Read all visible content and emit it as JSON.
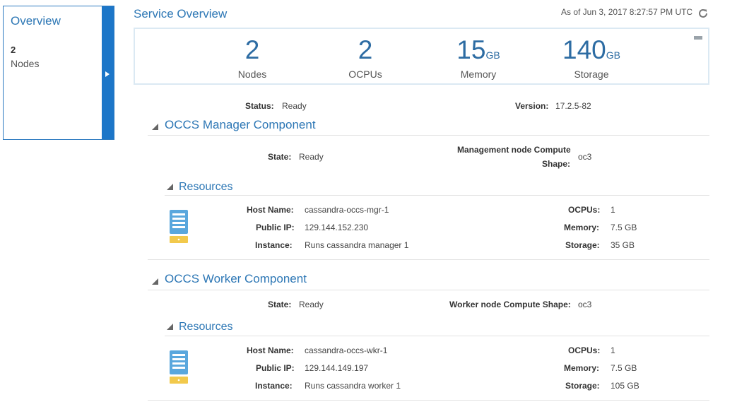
{
  "sidebar": {
    "title": "Overview",
    "count": "2",
    "count_label": "Nodes"
  },
  "header": {
    "title": "Service Overview",
    "as_of": "As of Jun 3, 2017 8:27:57 PM UTC"
  },
  "metrics": [
    {
      "value": "2",
      "unit": "",
      "label": "Nodes"
    },
    {
      "value": "2",
      "unit": "",
      "label": "OCPUs"
    },
    {
      "value": "15",
      "unit": "GB",
      "label": "Memory"
    },
    {
      "value": "140",
      "unit": "GB",
      "label": "Storage"
    }
  ],
  "status": {
    "status_label": "Status:",
    "status_value": "Ready",
    "version_label": "Version:",
    "version_value": "17.2.5-82"
  },
  "manager": {
    "title": "OCCS Manager Component",
    "state_label": "State:",
    "state_value": "Ready",
    "shape_label_line1": "Management node Compute",
    "shape_label_line2": "Shape:",
    "shape_value": "oc3",
    "resources_title": "Resources",
    "host_label": "Host Name:",
    "host_value": "cassandra-occs-mgr-1",
    "ip_label": "Public IP:",
    "ip_value": "129.144.152.230",
    "instance_label": "Instance:",
    "instance_value": "Runs cassandra manager 1",
    "ocpus_label": "OCPUs:",
    "ocpus_value": "1",
    "memory_label": "Memory:",
    "memory_value": "7.5 GB",
    "storage_label": "Storage:",
    "storage_value": "35 GB"
  },
  "worker": {
    "title": "OCCS Worker Component",
    "state_label": "State:",
    "state_value": "Ready",
    "shape_label": "Worker node Compute Shape:",
    "shape_value": "oc3",
    "resources_title": "Resources",
    "host_label": "Host Name:",
    "host_value": "cassandra-occs-wkr-1",
    "ip_label": "Public IP:",
    "ip_value": "129.144.149.197",
    "instance_label": "Instance:",
    "instance_value": "Runs cassandra worker 1",
    "ocpus_label": "OCPUs:",
    "ocpus_value": "1",
    "memory_label": "Memory:",
    "memory_value": "7.5 GB",
    "storage_label": "Storage:",
    "storage_value": "105 GB"
  },
  "colors": {
    "accent": "#2d77b5",
    "sidebar_strip": "#1c76c8",
    "server_icon": "#5aa7dd",
    "server_disk": "#f2c94c"
  }
}
